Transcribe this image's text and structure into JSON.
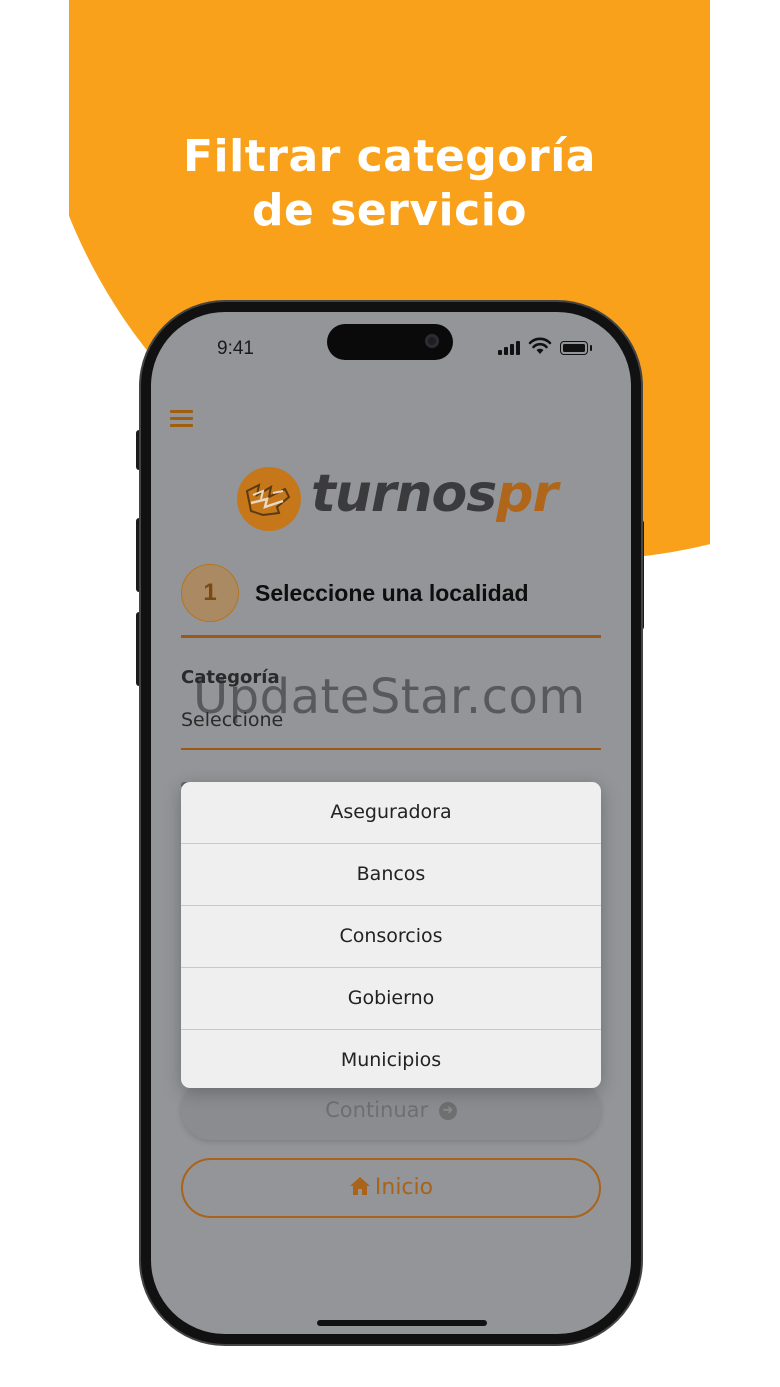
{
  "banner": {
    "line1": "Filtrar categoría",
    "line2": "de servicio"
  },
  "status_bar": {
    "time": "9:41"
  },
  "app": {
    "menu_icon": "hamburger-icon",
    "logo_text_main": "turnos",
    "logo_text_accent": "pr",
    "step": {
      "number": "1",
      "title": "Seleccione una localidad"
    },
    "category": {
      "label": "Categoría",
      "value": "Seleccione"
    },
    "dropdown_options": [
      "Aseguradora",
      "Bancos",
      "Consorcios",
      "Gobierno",
      "Municipios"
    ],
    "continue_button": "Continuar",
    "continue_icon": "arrow-circle-right-icon",
    "home_button": "Inicio",
    "home_icon": "home-icon"
  },
  "watermark": "UpdateStar.com",
  "colors": {
    "orange": "#F9A11B",
    "accent": "#A9631A",
    "screen_dim": "#939598",
    "dropdown_bg": "#efefef"
  }
}
